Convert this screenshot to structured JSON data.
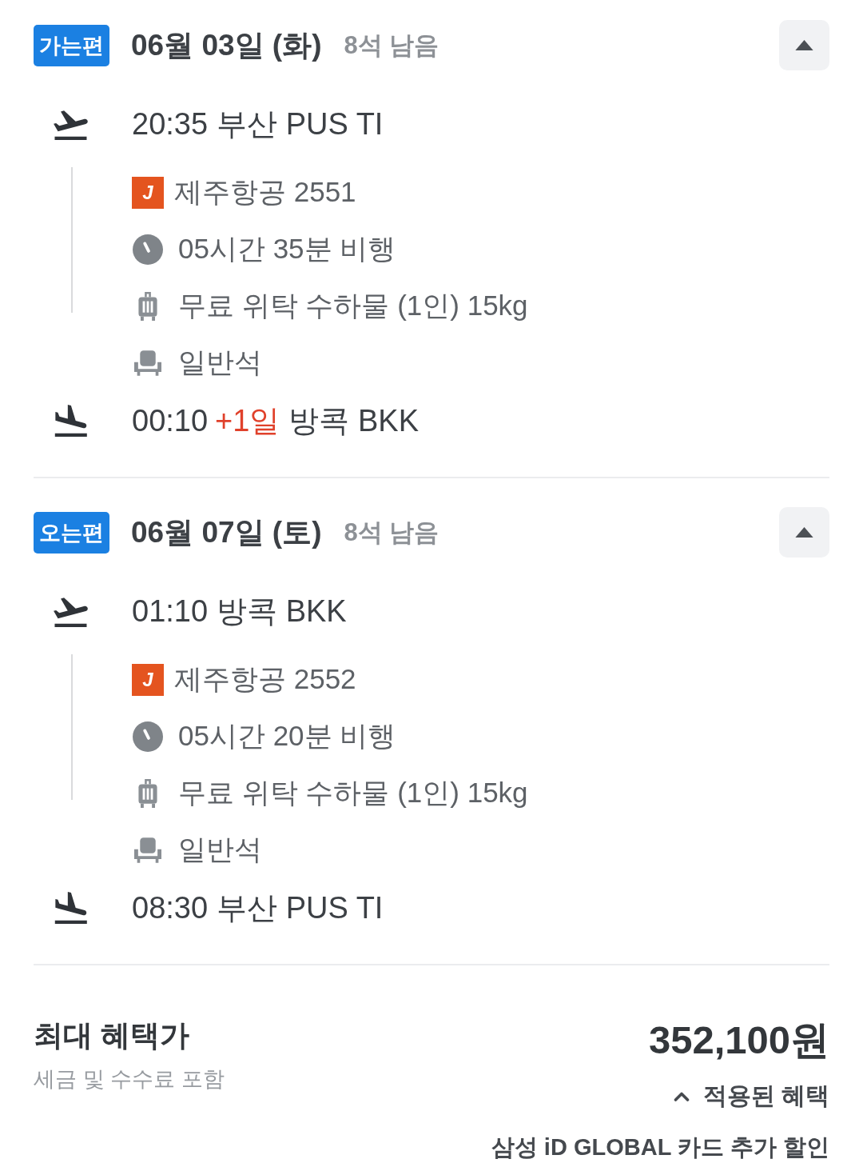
{
  "legs": [
    {
      "tag": "가는편",
      "date": "06월 03일 (화)",
      "seats_left": "8석 남음",
      "expanded": true,
      "departure": {
        "time": "20:35",
        "place": "부산 PUS TI"
      },
      "details": [
        {
          "kind": "airline",
          "logo": "J",
          "text": "제주항공 2551"
        },
        {
          "kind": "duration",
          "text": "05시간 35분 비행"
        },
        {
          "kind": "baggage",
          "text": "무료 위탁 수하물 (1인) 15kg"
        },
        {
          "kind": "seat",
          "text": "일반석"
        }
      ],
      "arrival": {
        "time": "00:10",
        "day_offset": "+1일",
        "place": "방콕 BKK"
      }
    },
    {
      "tag": "오는편",
      "date": "06월 07일 (토)",
      "seats_left": "8석 남음",
      "expanded": true,
      "departure": {
        "time": "01:10",
        "place": "방콕 BKK"
      },
      "details": [
        {
          "kind": "airline",
          "logo": "J",
          "text": "제주항공 2552"
        },
        {
          "kind": "duration",
          "text": "05시간 20분 비행"
        },
        {
          "kind": "baggage",
          "text": "무료 위탁 수하물 (1인) 15kg"
        },
        {
          "kind": "seat",
          "text": "일반석"
        }
      ],
      "arrival": {
        "time": "08:30",
        "place": "부산 PUS TI"
      }
    }
  ],
  "price": {
    "label": "최대 혜택가",
    "note": "세금 및 수수료 포함",
    "amount": "352,100원",
    "benefits_toggle": {
      "label": "적용된 혜택",
      "expanded": true
    },
    "benefits": [
      "삼성 iD GLOBAL 카드 추가 할인"
    ]
  }
}
